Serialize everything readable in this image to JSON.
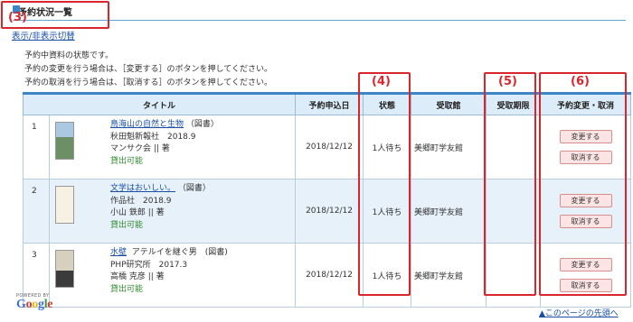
{
  "header": {
    "title": "予約状況一覧",
    "toggle_link": "表示/非表示切替"
  },
  "intro": [
    "予約中資料の状態です。",
    "予約の変更を行う場合は、［変更する］のボタンを押してください。",
    "予約の取消を行う場合は、［取消する］のボタンを押してください。"
  ],
  "annotations": [
    "(3)",
    "(4)",
    "(5)",
    "(6)"
  ],
  "table": {
    "headers": [
      "タイトル",
      "予約申込日",
      "状態",
      "受取館",
      "受取期限",
      "予約変更・取消"
    ],
    "rows": [
      {
        "num": "1",
        "title": "鳥海山の自然と生物",
        "title_prefix": "",
        "format": "（図書）",
        "publisher_line": "秋田魁新報社　2018.9",
        "author_line": "マンサク会 || 著",
        "availability": "貸出可能",
        "date": "2018/12/12",
        "status": "1人待ち",
        "library": "美郷町学友館",
        "deadline": "",
        "change_label": "変更する",
        "cancel_label": "取消する",
        "cover_color": "#8fb6d4"
      },
      {
        "num": "2",
        "title": "文学はおいしい。",
        "title_prefix": "",
        "format": "（図書）",
        "publisher_line": "作品社　2018.9",
        "author_line": "小山 鉄郎 || 著",
        "availability": "貸出可能",
        "date": "2018/12/12",
        "status": "1人待ち",
        "library": "美郷町学友館",
        "deadline": "",
        "change_label": "変更する",
        "cancel_label": "取消する",
        "cover_color": "#f3efe4"
      },
      {
        "num": "3",
        "title": "水壁",
        "title_prefix": "アテルイを継ぐ男　(図書)",
        "format": "",
        "publisher_line": "PHP研究所　2017.3",
        "author_line": "高橋 克彦 || 著",
        "availability": "貸出可能",
        "date": "2018/12/12",
        "status": "1人待ち",
        "library": "美郷町学友館",
        "deadline": "",
        "change_label": "変更する",
        "cancel_label": "取消する",
        "cover_color": "#cfc6b4"
      }
    ]
  },
  "footer": {
    "google_small": "POWERED BY",
    "google_g": "G",
    "google_o1": "o",
    "google_o2": "o",
    "google_g2": "g",
    "google_l": "l",
    "google_e": "e",
    "to_top": "▲このページの先頭へ"
  }
}
